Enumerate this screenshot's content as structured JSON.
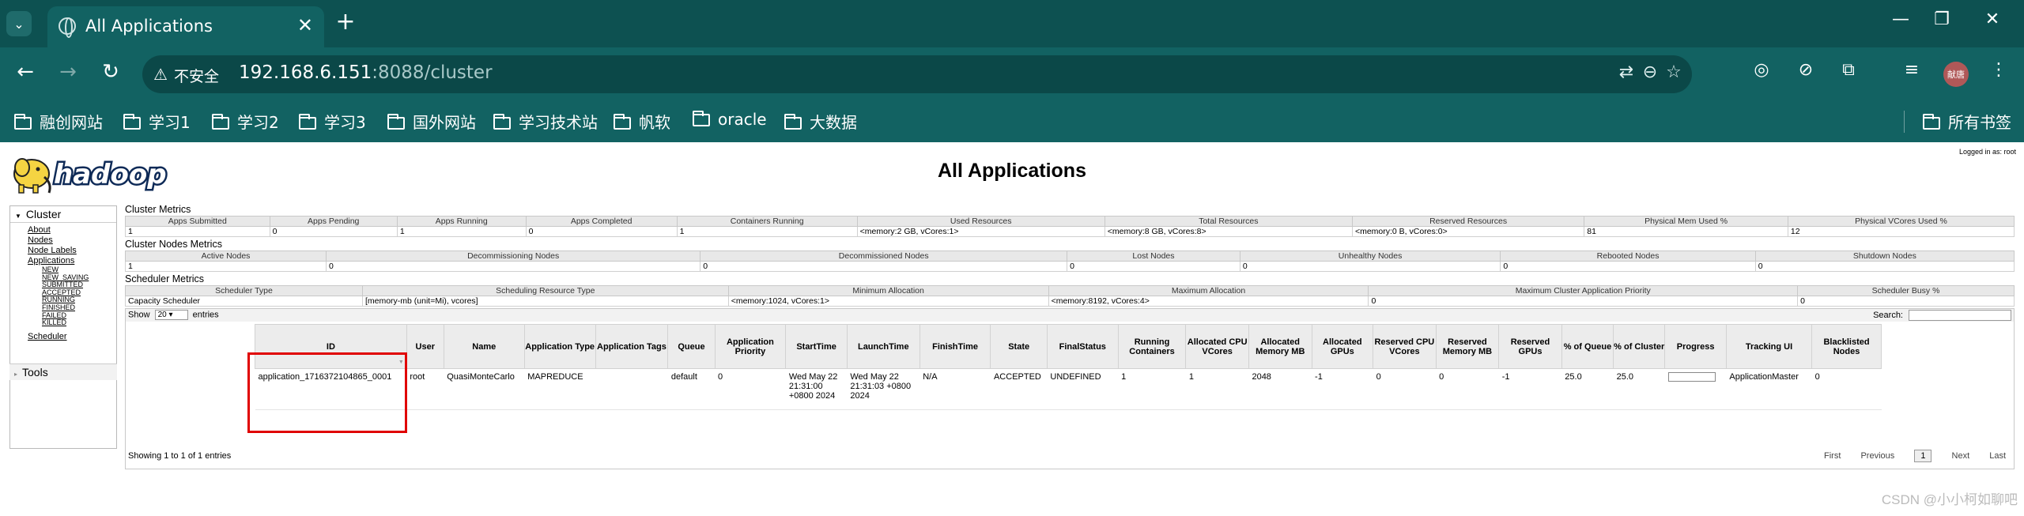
{
  "browser": {
    "tab_title": "All Applications",
    "omnibox": {
      "security_label": "不安全",
      "url_host": "192.168.6.151",
      "url_rest": ":8088/cluster"
    },
    "avatar_label": "献唐",
    "bookmarks": [
      "融创网站",
      "学习1",
      "学习2",
      "学习3",
      "国外网站",
      "学习技术站",
      "帆软",
      "oracle",
      "大数据"
    ],
    "all_bookmarks": "所有书签",
    "theme_color": "#126262"
  },
  "page": {
    "title": "All Applications",
    "logged_in": "Logged in as: root",
    "logo_text": "hadoop"
  },
  "nav": {
    "cluster_label": "Cluster",
    "links": [
      "About",
      "Nodes",
      "Node Labels",
      "Applications"
    ],
    "app_states": [
      "NEW",
      "NEW_SAVING",
      "SUBMITTED",
      "ACCEPTED",
      "RUNNING",
      "FINISHED",
      "FAILED",
      "KILLED"
    ],
    "scheduler": "Scheduler",
    "tools_label": "Tools"
  },
  "cluster_metrics": {
    "title": "Cluster Metrics",
    "headers": [
      "Apps Submitted",
      "Apps Pending",
      "Apps Running",
      "Apps Completed",
      "Containers Running",
      "Used Resources",
      "Total Resources",
      "Reserved Resources",
      "Physical Mem Used %",
      "Physical VCores Used %"
    ],
    "values": [
      "1",
      "0",
      "1",
      "0",
      "1",
      "<memory:2 GB, vCores:1>",
      "<memory:8 GB, vCores:8>",
      "<memory:0 B, vCores:0>",
      "81",
      "12"
    ]
  },
  "cluster_nodes_metrics": {
    "title": "Cluster Nodes Metrics",
    "headers": [
      "Active Nodes",
      "Decommissioning Nodes",
      "Decommissioned Nodes",
      "Lost Nodes",
      "Unhealthy Nodes",
      "Rebooted Nodes",
      "Shutdown Nodes"
    ],
    "values": [
      "1",
      "0",
      "0",
      "0",
      "0",
      "0",
      "0"
    ]
  },
  "scheduler_metrics": {
    "title": "Scheduler Metrics",
    "headers": [
      "Scheduler Type",
      "Scheduling Resource Type",
      "Minimum Allocation",
      "Maximum Allocation",
      "Maximum Cluster Application Priority",
      "Scheduler Busy %"
    ],
    "values": [
      "Capacity Scheduler",
      "[memory-mb (unit=Mi), vcores]",
      "<memory:1024, vCores:1>",
      "<memory:8192, vCores:4>",
      "0",
      "0"
    ]
  },
  "apps_table": {
    "show_label": "Show",
    "entries_value": "20",
    "entries_label": "entries",
    "search_label": "Search:",
    "headers": [
      "ID",
      "User",
      "Name",
      "Application Type",
      "Application Tags",
      "Queue",
      "Application Priority",
      "StartTime",
      "LaunchTime",
      "FinishTime",
      "State",
      "FinalStatus",
      "Running Containers",
      "Allocated CPU VCores",
      "Allocated Memory MB",
      "Allocated GPUs",
      "Reserved CPU VCores",
      "Reserved Memory MB",
      "Reserved GPUs",
      "% of Queue",
      "% of Cluster",
      "Progress",
      "Tracking UI",
      "Blacklisted Nodes"
    ],
    "row": {
      "id": "application_1716372104865_0001",
      "user": "root",
      "name": "QuasiMonteCarlo",
      "type": "MAPREDUCE",
      "tags": "",
      "queue": "default",
      "priority": "0",
      "start_time": "Wed May 22 21:31:00 +0800 2024",
      "launch_time": "Wed May 22 21:31:03 +0800 2024",
      "finish_time": "N/A",
      "state": "ACCEPTED",
      "final_status": "UNDEFINED",
      "running_containers": "1",
      "alloc_vcores": "1",
      "alloc_mem": "2048",
      "alloc_gpus": "-1",
      "res_vcores": "0",
      "res_mem": "0",
      "res_gpus": "-1",
      "pct_queue": "25.0",
      "pct_cluster": "25.0",
      "progress": 0,
      "tracking_ui": "ApplicationMaster",
      "blacklisted": "0"
    },
    "showing": "Showing 1 to 1 of 1 entries",
    "pager": {
      "first": "First",
      "previous": "Previous",
      "current": "1",
      "next": "Next",
      "last": "Last"
    }
  },
  "watermark": "CSDN @小小柯如聊吧"
}
